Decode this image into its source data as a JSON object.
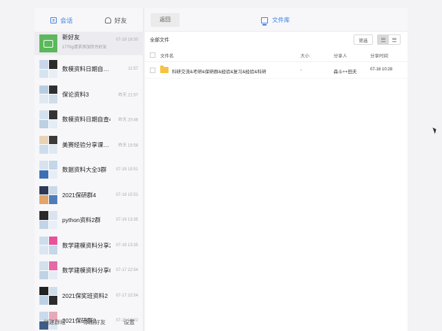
{
  "tabs": [
    {
      "label": "会话",
      "active": true,
      "icon": "chat-icon"
    },
    {
      "label": "好友",
      "active": false,
      "icon": "friend-icon"
    }
  ],
  "conversations": [
    {
      "name": "新好友",
      "sub": "1770g请求添加你为好友",
      "time": "07-18 16:30",
      "avatar": "green"
    },
    {
      "name": "数模资料日期自…",
      "sub": "",
      "time": "11:57",
      "avatar": "grid"
    },
    {
      "name": "保论资料3",
      "sub": "",
      "time": "昨天 21:57",
      "avatar": "grid"
    },
    {
      "name": "数模资料日期自查4",
      "sub": "",
      "time": "昨天 20:46",
      "avatar": "grid"
    },
    {
      "name": "美赛经验分享课…",
      "sub": "",
      "time": "昨天 15:58",
      "avatar": "grid"
    },
    {
      "name": "数据资料大全3群",
      "sub": "",
      "time": "07-19 15:51",
      "avatar": "grid"
    },
    {
      "name": "2021保研群4",
      "sub": "",
      "time": "07-19 15:51",
      "avatar": "grid"
    },
    {
      "name": "python资料2群",
      "sub": "",
      "time": "07-19 13:35",
      "avatar": "grid"
    },
    {
      "name": "数学建模资料分享2",
      "sub": "",
      "time": "07-19 13:35",
      "avatar": "grid"
    },
    {
      "name": "数学建模资料分享6",
      "sub": "",
      "time": "07-17 22:54",
      "avatar": "grid"
    },
    {
      "name": "2021保奖班资料2",
      "sub": "",
      "time": "07-17 22:54",
      "avatar": "grid"
    },
    {
      "name": "2021保研群2",
      "sub": "",
      "time": "07-15 10:22",
      "avatar": "grid"
    }
  ],
  "footer": {
    "create_group": "创建群组",
    "add_friend": "添加好友",
    "settings": "设置"
  },
  "topbar": {
    "back": "返回",
    "title": "文件库"
  },
  "toolbar": {
    "all_files": "全部文件",
    "filter": "筛选"
  },
  "table": {
    "headers": {
      "name": "文件名",
      "size": "大小",
      "sharer": "分享人",
      "time": "分享时间"
    },
    "rows": [
      {
        "name": "科研交流&考研&保研群&经验&复习&经验&科研",
        "size": "-",
        "sharer": "森斗++田夫",
        "time": "07-16 10:28"
      }
    ]
  },
  "colors": {
    "accent": "#3a80e6",
    "folder": "#f5c342",
    "green_avatar": "#5cb85c"
  }
}
